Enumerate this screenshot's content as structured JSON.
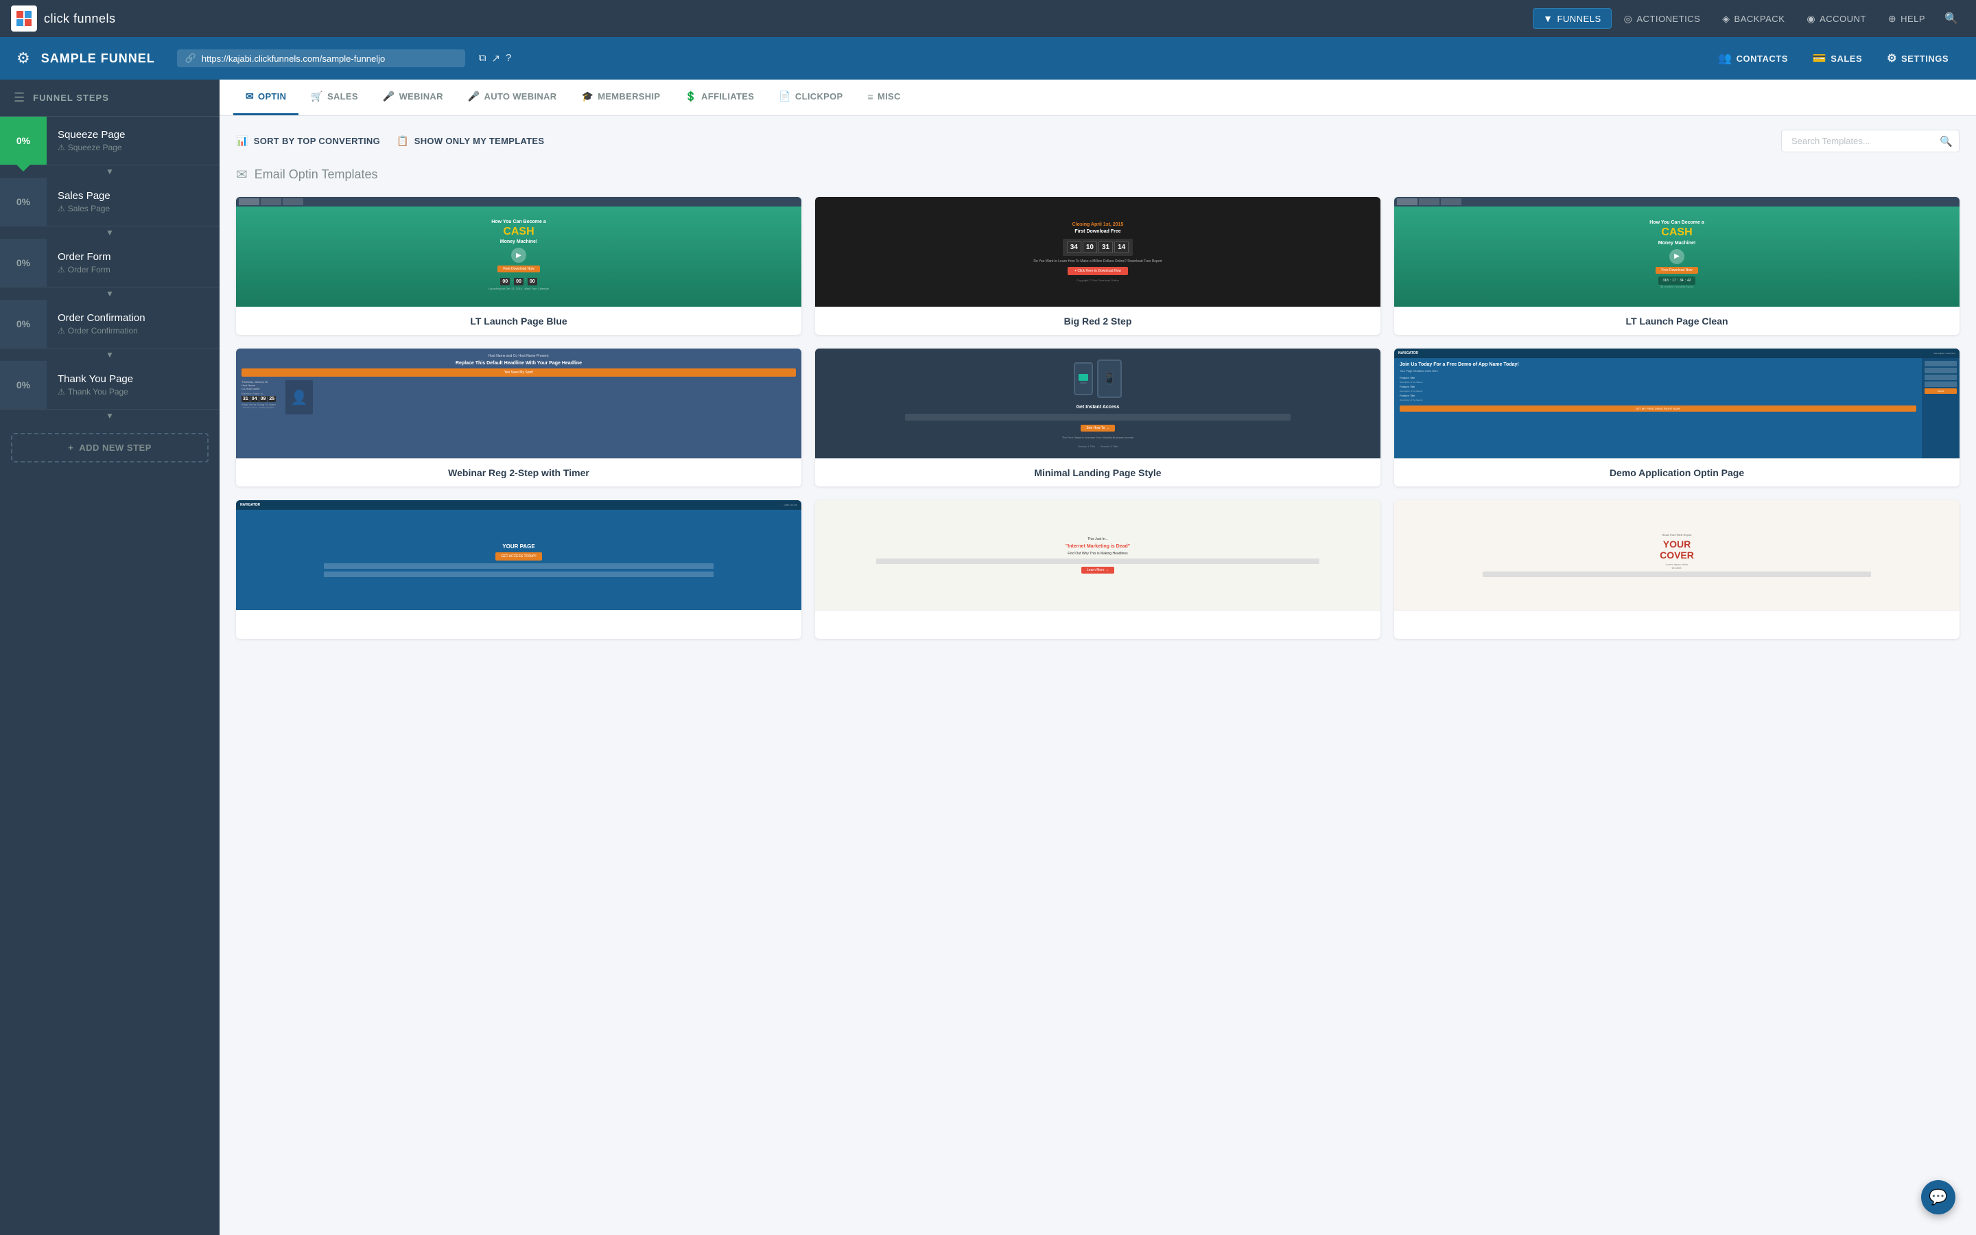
{
  "app": {
    "logo_text": "click funnels",
    "logo_icon": "cf"
  },
  "top_nav": {
    "items": [
      {
        "id": "funnels",
        "label": "FUNNELS",
        "icon": "▼",
        "active": true
      },
      {
        "id": "actionetics",
        "label": "ACTIONETICS",
        "icon": "🎧"
      },
      {
        "id": "backpack",
        "label": "BACKPACK",
        "icon": "🎒"
      },
      {
        "id": "account",
        "label": "ACCOUNT",
        "icon": "👤"
      },
      {
        "id": "help",
        "label": "HELP",
        "icon": "🌐"
      }
    ]
  },
  "funnel_header": {
    "title": "SAMPLE FUNNEL",
    "url": "https://kajabi.clickfunnels.com/sample-funneljo",
    "contacts_label": "CONTACTS",
    "sales_label": "SALES",
    "settings_label": "SETTINGS"
  },
  "sidebar": {
    "header": "FUNNEL STEPS",
    "steps": [
      {
        "id": "squeeze",
        "percent": "0%",
        "name": "Squeeze Page",
        "sub": "Squeeze Page",
        "active": true
      },
      {
        "id": "sales",
        "percent": "0%",
        "name": "Sales Page",
        "sub": "Sales Page",
        "active": false
      },
      {
        "id": "order-form",
        "percent": "0%",
        "name": "Order Form",
        "sub": "Order Form",
        "active": false
      },
      {
        "id": "order-confirm",
        "percent": "0%",
        "name": "Order Confirmation",
        "sub": "Order Confirmation",
        "active": false
      },
      {
        "id": "thank-you",
        "percent": "0%",
        "name": "Thank You Page",
        "sub": "Thank You Page",
        "active": false
      }
    ],
    "add_step_label": "ADD NEW STEP"
  },
  "template_tabs": [
    {
      "id": "optin",
      "label": "OPTIN",
      "icon": "✉",
      "active": true
    },
    {
      "id": "sales",
      "label": "SALES",
      "icon": "🛒",
      "active": false
    },
    {
      "id": "webinar",
      "label": "WEBINAR",
      "icon": "🎤",
      "active": false
    },
    {
      "id": "auto-webinar",
      "label": "AUTO WEBINAR",
      "icon": "🎤",
      "active": false
    },
    {
      "id": "membership",
      "label": "MEMBERSHIP",
      "icon": "🎓",
      "active": false
    },
    {
      "id": "affiliates",
      "label": "AFFILIATES",
      "icon": "💲",
      "active": false
    },
    {
      "id": "clickpop",
      "label": "CLICKPOP",
      "icon": "📄",
      "active": false
    },
    {
      "id": "misc",
      "label": "MISC",
      "icon": "≡",
      "active": false
    }
  ],
  "filters": {
    "sort_label": "SORT BY TOP CONVERTING",
    "show_only_label": "SHOW ONLY MY TEMPLATES",
    "search_placeholder": "Search Templates..."
  },
  "section": {
    "title": "Email Optin Templates",
    "icon": "✉"
  },
  "templates": [
    {
      "id": "lt-launch-blue",
      "label": "LT Launch Page Blue",
      "thumb_type": "lt-blue",
      "hero_text": "How You Can Become a CASH Money Machine!",
      "has_timer": true,
      "timer": [
        "00",
        "00",
        "00",
        "00"
      ],
      "btn_text": "Free Download Now"
    },
    {
      "id": "big-red-2step",
      "label": "Big Red 2 Step",
      "thumb_type": "big-red",
      "hero_text": "Closing April 1st, 2015 First Download Free",
      "has_countdown": true,
      "countdown": [
        "34",
        "10",
        "31",
        "14"
      ]
    },
    {
      "id": "lt-launch-clean",
      "label": "LT Launch Page Clean",
      "thumb_type": "lt-clean",
      "hero_text": "How You Can Become a CASH Money Machine!",
      "has_timer2": true,
      "timer2_top": [
        "318",
        "17",
        "34",
        "42"
      ],
      "timer2_bot": "3:"
    },
    {
      "id": "webinar-reg",
      "label": "Webinar Reg 2-Step with Timer",
      "thumb_type": "webinar",
      "hero_text": "Replace This Default Headline With Your Page Headline"
    },
    {
      "id": "minimal-landing",
      "label": "Minimal Landing Page Style",
      "thumb_type": "minimal",
      "hero_text": "Get Instant Access"
    },
    {
      "id": "demo-application",
      "label": "Demo Application Optin Page",
      "thumb_type": "demo",
      "hero_text": "Join Us Today For a Free Demo of App Name Today!"
    }
  ],
  "bottom_templates": [
    {
      "id": "navigator-optin",
      "label": "",
      "thumb_type": "navigator"
    },
    {
      "id": "internet-marketing",
      "label": "",
      "thumb_type": "internet-marketing"
    },
    {
      "id": "cover",
      "label": "",
      "thumb_type": "cover"
    }
  ]
}
